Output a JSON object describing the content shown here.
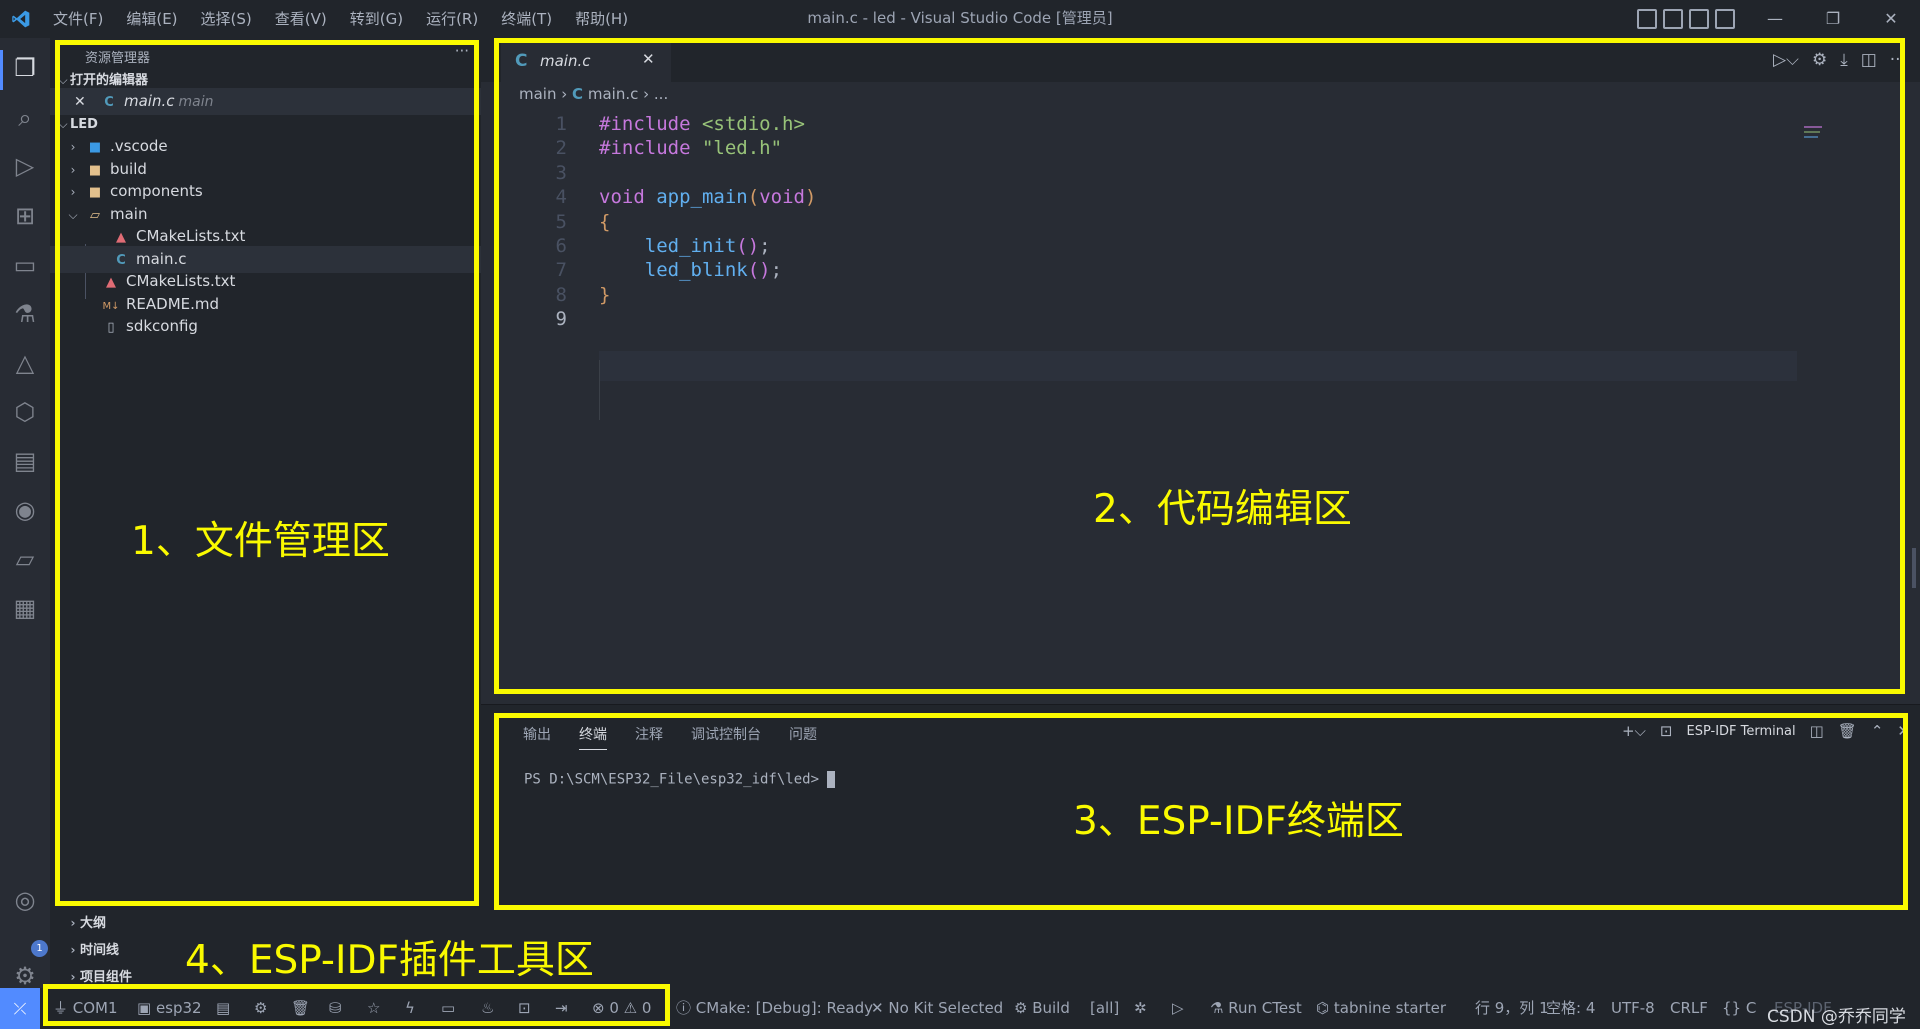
{
  "titlebar": {
    "menu": [
      "文件(F)",
      "编辑(E)",
      "选择(S)",
      "查看(V)",
      "转到(G)",
      "运行(R)",
      "终端(T)",
      "帮助(H)"
    ],
    "title": "main.c - led - Visual Studio Code [管理员]"
  },
  "sidebar": {
    "header": "资源管理器",
    "open_editors_title": "打开的编辑器",
    "open_editor_name": "main.c",
    "open_editor_desc": "main",
    "folder_title": "LED",
    "tree": [
      ".vscode",
      "build",
      "components",
      "main",
      "CMakeLists.txt",
      "main.c",
      "CMakeLists.txt",
      "README.md",
      "sdkconfig"
    ],
    "outline": "大纲",
    "timeline": "时间线",
    "project_components": "项目组件",
    "badge": "1"
  },
  "editor": {
    "tab_label": "main.c",
    "breadcrumb": {
      "folder": "main",
      "file": "main.c",
      "more": "..."
    },
    "line_numbers": [
      "1",
      "2",
      "3",
      "4",
      "5",
      "6",
      "7",
      "8",
      "9"
    ],
    "code": {
      "l1_kw": "#include",
      "l1_str": "<stdio.h>",
      "l2_kw": "#include",
      "l2_str": "\"led.h\"",
      "l4_kw": "void",
      "l4_fn": "app_main",
      "l4_open": "(",
      "l4_kw2": "void",
      "l4_close": ")",
      "l5": "{",
      "l6_fn": "led_init",
      "l6_paren": "()",
      "l6_semi": ";",
      "l7_fn": "led_blink",
      "l7_paren": "()",
      "l7_semi": ";",
      "l8": "}"
    }
  },
  "panel": {
    "tabs": [
      "输出",
      "终端",
      "注释",
      "调试控制台",
      "问题"
    ],
    "terminal_name": "ESP-IDF Terminal",
    "prompt": "PS D:\\SCM\\ESP32_File\\esp32_idf\\led>"
  },
  "statusbar": {
    "port": "COM1",
    "target": "esp32",
    "errors": "0",
    "warnings": "0",
    "cmake": "CMake: [Debug]: Ready",
    "kit": "No Kit Selected",
    "build": "Build",
    "build_target": "[all]",
    "ctest": "Run CTest",
    "tabnine": "tabnine starter",
    "position": "行 9，列 1",
    "spaces": "空格: 4",
    "encoding": "UTF-8",
    "eol": "CRLF",
    "language": "{} C",
    "esp_idf": "ESP-IDF"
  },
  "annotations": {
    "a1": "1、文件管理区",
    "a2": "2、代码编辑区",
    "a3": "3、ESP-IDF终端区",
    "a4": "4、ESP-IDF插件工具区",
    "watermark": "CSDN @乔乔同学"
  },
  "colors": {
    "accent": "#528bff",
    "annotation": "#fafa00",
    "keyword": "#c678dd",
    "string": "#98c379",
    "function": "#61afef"
  }
}
